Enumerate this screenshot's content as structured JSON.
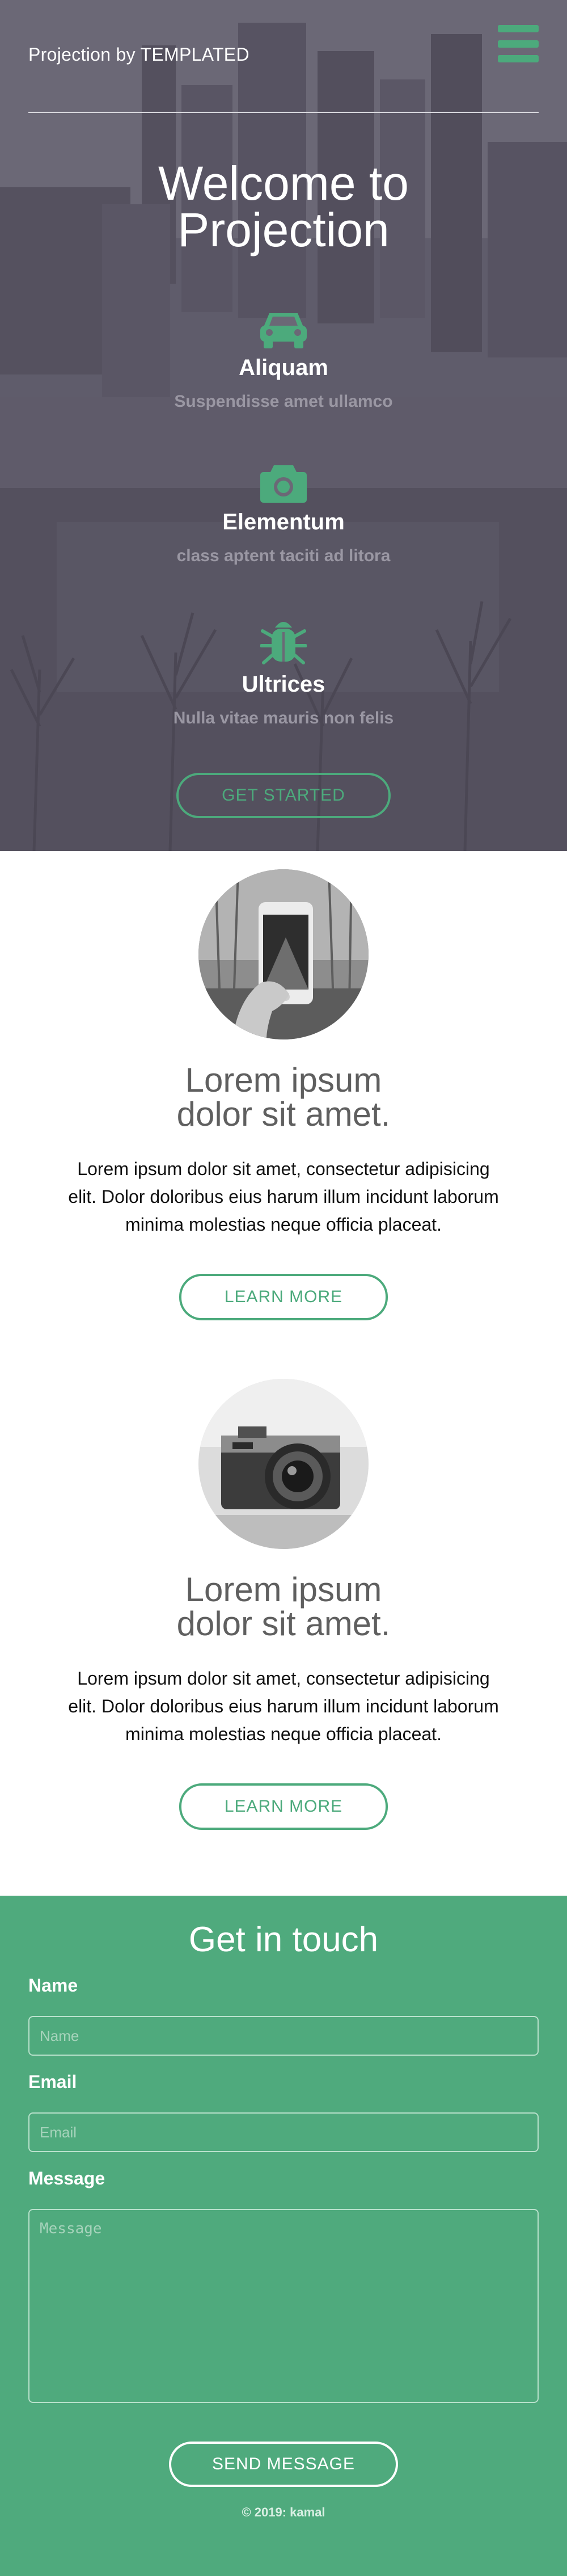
{
  "header": {
    "brand": "Projection by TEMPLATED",
    "menu_icon": "hamburger-menu-icon",
    "accent_color": "#4caa7c"
  },
  "hero": {
    "title_line1": "Welcome to",
    "title_line2": "Projection",
    "features": [
      {
        "icon": "car-icon",
        "title": "Aliquam",
        "subtitle": "Suspendisse amet ullamco"
      },
      {
        "icon": "camera-icon",
        "title": "Elementum",
        "subtitle": "class aptent taciti ad litora"
      },
      {
        "icon": "bug-icon",
        "title": "Ultrices",
        "subtitle": "Nulla vitae mauris non felis"
      }
    ],
    "cta_label": "GET STARTED"
  },
  "articles": [
    {
      "image": "phone-photo",
      "title_line1": "Lorem ipsum",
      "title_line2": "dolor sit amet.",
      "text": "Lorem ipsum dolor sit amet, consectetur adipisicing elit. Dolor doloribus eius harum illum incidunt laborum minima molestias neque officia placeat.",
      "button_label": "LEARN MORE"
    },
    {
      "image": "camera-photo",
      "title_line1": "Lorem ipsum",
      "title_line2": "dolor sit amet.",
      "text": "Lorem ipsum dolor sit amet, consectetur adipisicing elit. Dolor doloribus eius harum illum incidunt laborum minima molestias neque officia placeat.",
      "button_label": "LEARN MORE"
    }
  ],
  "contact": {
    "title": "Get in touch",
    "name_label": "Name",
    "name_placeholder": "Name",
    "email_label": "Email",
    "email_placeholder": "Email",
    "message_label": "Message",
    "message_placeholder": "Message",
    "send_label": "SEND MESSAGE",
    "background_color": "#4faa7d"
  },
  "footer": {
    "copyright": "© 2019: kamal"
  }
}
